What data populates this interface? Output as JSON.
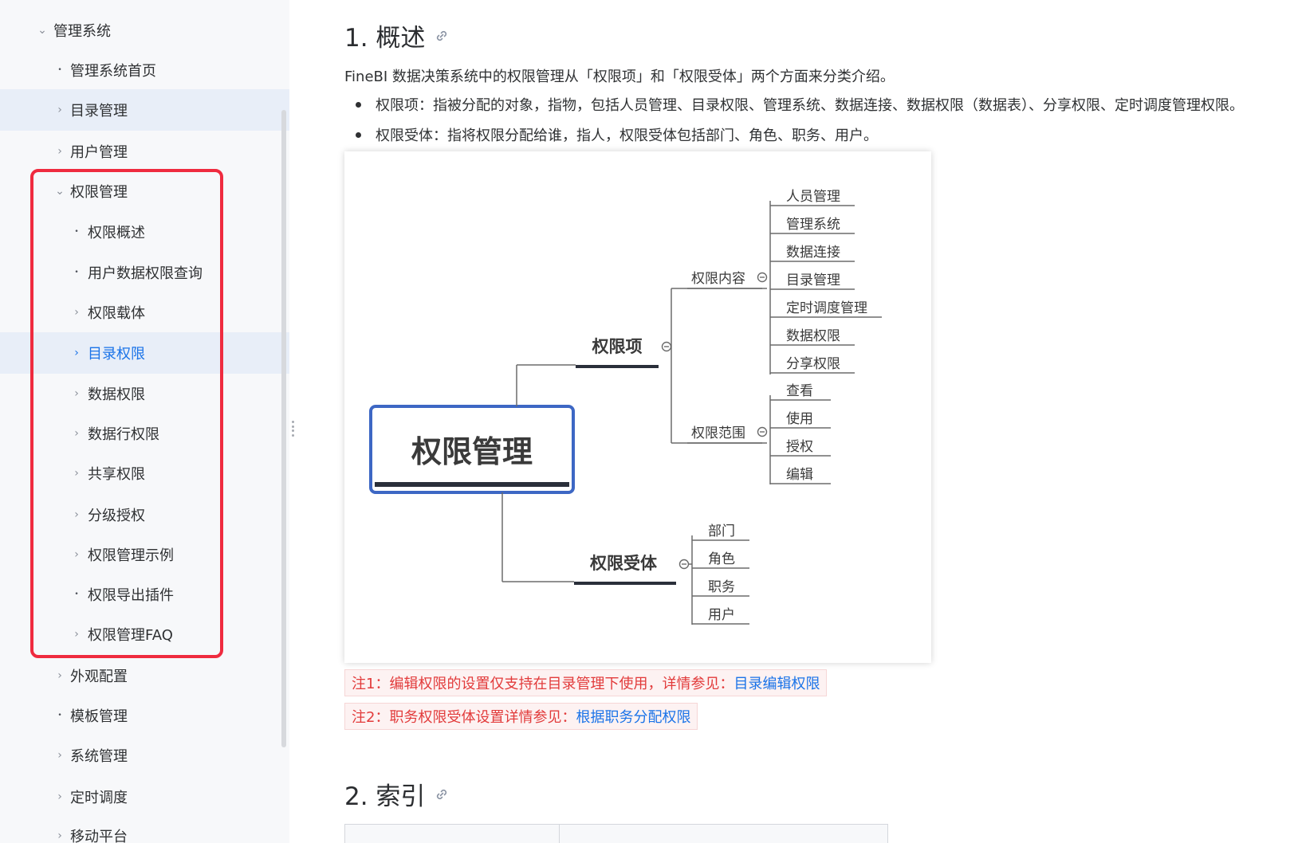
{
  "sidebar": {
    "items": [
      {
        "label": "管理系统",
        "marker": "⌄",
        "level": 0
      },
      {
        "label": "管理系统首页",
        "marker": "•",
        "level": 1
      },
      {
        "label": "目录管理",
        "marker": "›",
        "level": 1,
        "highlighted": true
      },
      {
        "label": "用户管理",
        "marker": "›",
        "level": 1
      },
      {
        "label": "权限管理",
        "marker": "⌄",
        "level": 1
      },
      {
        "label": "权限概述",
        "marker": "•",
        "level": 2
      },
      {
        "label": "用户数据权限查询",
        "marker": "•",
        "level": 2
      },
      {
        "label": "权限载体",
        "marker": "›",
        "level": 2
      },
      {
        "label": "目录权限",
        "marker": "›",
        "level": 2,
        "highlighted": true,
        "active": true
      },
      {
        "label": "数据权限",
        "marker": "›",
        "level": 2
      },
      {
        "label": "数据行权限",
        "marker": "›",
        "level": 2
      },
      {
        "label": "共享权限",
        "marker": "›",
        "level": 2
      },
      {
        "label": "分级授权",
        "marker": "›",
        "level": 2
      },
      {
        "label": "权限管理示例",
        "marker": "›",
        "level": 2
      },
      {
        "label": "权限导出插件",
        "marker": "•",
        "level": 2
      },
      {
        "label": "权限管理FAQ",
        "marker": "›",
        "level": 2
      },
      {
        "label": "外观配置",
        "marker": "›",
        "level": 1
      },
      {
        "label": "模板管理",
        "marker": "•",
        "level": 1
      },
      {
        "label": "系统管理",
        "marker": "›",
        "level": 1
      },
      {
        "label": "定时调度",
        "marker": "›",
        "level": 1
      },
      {
        "label": "移动平台",
        "marker": "›",
        "level": 1
      }
    ],
    "colors": {
      "highlight_box": "#ef2b3f",
      "active_text": "#1a73e8",
      "row_highlight": "#e8eef8"
    }
  },
  "content": {
    "section1_title": "1. 概述",
    "intro": "FineBI 数据决策系统中的权限管理从「权限项」和「权限受体」两个方面来分类介绍。",
    "bullets": [
      "权限项：指被分配的对象，指物，包括人员管理、目录权限、管理系统、数据连接、数据权限（数据表）、分享权限、定时调度管理权限。",
      "权限受体：指将权限分配给谁，指人，权限受体包括部门、角色、职务、用户。"
    ],
    "notes": [
      {
        "text": "注1：编辑权限的设置仅支持在目录管理下使用，详情参见：",
        "link": "目录编辑权限"
      },
      {
        "text": "注2：职务权限受体设置详情参见：",
        "link": "根据职务分配权限"
      }
    ],
    "section2_title": "2. 索引"
  },
  "mindmap": {
    "root": "权限管理",
    "branch1": "权限项",
    "branch1_children": [
      {
        "label": "权限内容",
        "leaves": [
          "人员管理",
          "管理系统",
          "数据连接",
          "目录管理",
          "定时调度管理",
          "数据权限",
          "分享权限"
        ]
      },
      {
        "label": "权限范围",
        "leaves": [
          "查看",
          "使用",
          "授权",
          "编辑"
        ]
      }
    ],
    "branch2": "权限受体",
    "branch2_leaves": [
      "部门",
      "角色",
      "职务",
      "用户"
    ],
    "colors": {
      "root_border": "#3d67c4",
      "line": "#6b6b6b",
      "underline": "#2a2f3a"
    }
  }
}
